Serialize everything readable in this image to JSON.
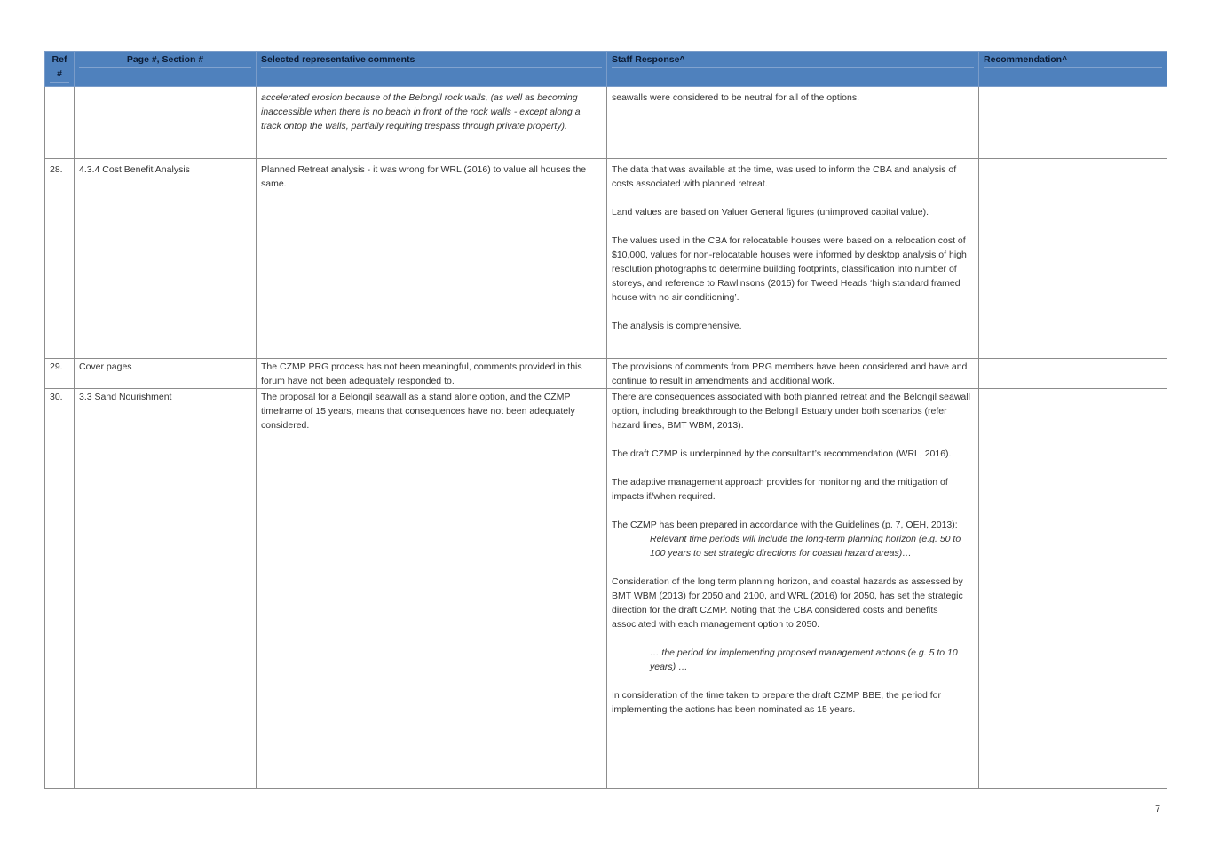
{
  "table": {
    "headers": {
      "ref": "Ref #",
      "page_section": "Page #, Section #",
      "comments": "Selected representative comments",
      "staff_response": "Staff Response^",
      "recommendation": "Recommendation^"
    },
    "rows": [
      {
        "ref": "",
        "section": "",
        "comment": "accelerated erosion because of the Belongil rock walls, (as well as becoming inaccessible when there is no beach in front of the rock walls - except along a track ontop the walls, partially requiring trespass through private property).",
        "response": [
          "seawalls were considered to be neutral for all of the options."
        ],
        "recommendation": ""
      },
      {
        "ref": "28.",
        "section": "4.3.4 Cost Benefit Analysis",
        "comment": "Planned Retreat analysis - it was wrong for WRL (2016) to value all houses the same.",
        "response": [
          "The data that was available at the time, was used to inform the CBA and analysis of costs associated with planned retreat.",
          "Land values are based on Valuer General figures (unimproved capital value).",
          "The values used in the CBA for relocatable houses were based on a relocation cost of $10,000, values for non-relocatable houses were informed by desktop analysis of high resolution photographs to determine building footprints, classification into number of storeys, and reference to Rawlinsons (2015) for Tweed Heads ‘high standard framed house with no air conditioning’.",
          "The analysis is comprehensive."
        ],
        "recommendation": ""
      },
      {
        "ref": "29.",
        "section": "Cover pages",
        "comment": "The CZMP PRG process has not been meaningful, comments provided in this forum have not been adequately responded to.",
        "response": [
          "The provisions of comments from PRG members have been considered and have and continue to result in amendments and additional work."
        ],
        "recommendation": ""
      },
      {
        "ref": "30.",
        "section": "3.3 Sand Nourishment",
        "comment": "The proposal for a Belongil seawall as a stand alone option, and the CZMP timeframe of 15 years, means that consequences have not been adequately considered.",
        "response_p1": "There are consequences associated with both planned retreat and the Belongil seawall option, including breakthrough to the Belongil Estuary under both scenarios (refer hazard lines, BMT WBM, 2013).",
        "response_p2": "The draft CZMP is underpinned by the consultant’s recommendation (WRL, 2016).",
        "response_p3": "The adaptive management approach provides for monitoring and the mitigation of impacts if/when required.",
        "response_p4": "The CZMP has been prepared in accordance with the Guidelines (p. 7, OEH, 2013):",
        "response_q1": "Relevant time periods will include the long-term planning horizon (e.g. 50 to 100 years to set strategic directions for coastal hazard areas)…",
        "response_p5": "Consideration of the long term planning horizon, and coastal hazards as assessed by BMT WBM (2013) for 2050 and 2100, and WRL (2016) for 2050, has set the strategic direction for the draft CZMP. Noting that the CBA considered costs and benefits associated with each management option to 2050.",
        "response_q2": "… the period for implementing proposed management actions (e.g. 5 to 10 years) …",
        "response_p6": "In consideration of the time taken to prepare the draft CZMP BBE, the period for implementing the actions has been nominated as 15 years.",
        "recommendation": ""
      }
    ]
  },
  "page_number": "7"
}
